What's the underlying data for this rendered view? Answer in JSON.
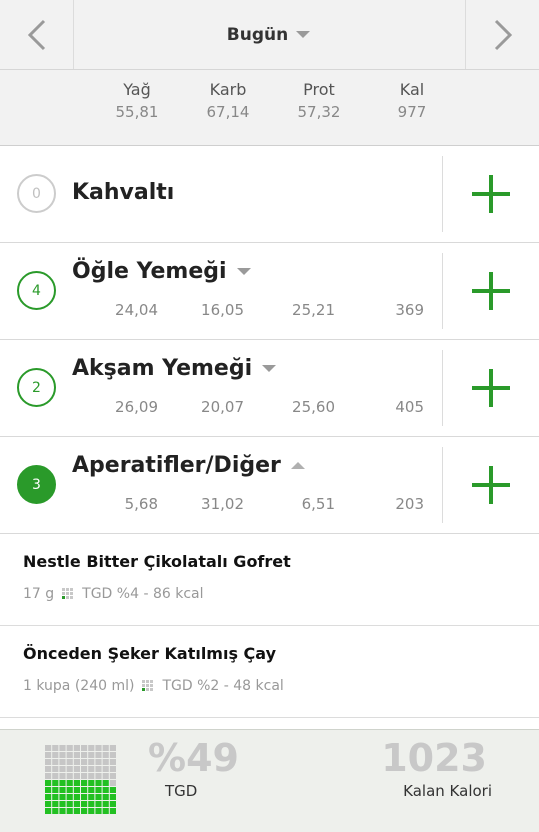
{
  "header": {
    "date_label": "Bugün"
  },
  "summary": {
    "fat": {
      "label": "Yağ",
      "value": "55,81"
    },
    "carb": {
      "label": "Karb",
      "value": "67,14"
    },
    "protein": {
      "label": "Prot",
      "value": "57,32"
    },
    "calories": {
      "label": "Kal",
      "value": "977"
    }
  },
  "meals": [
    {
      "count": "0",
      "name": "Kahvaltı"
    },
    {
      "count": "4",
      "name": "Öğle Yemeği",
      "fat": "24,04",
      "carb": "16,05",
      "protein": "25,21",
      "cal": "369"
    },
    {
      "count": "2",
      "name": "Akşam Yemeği",
      "fat": "26,09",
      "carb": "20,07",
      "protein": "25,60",
      "cal": "405"
    },
    {
      "count": "3",
      "name": "Aperatifler/Diğer",
      "fat": "5,68",
      "carb": "31,02",
      "protein": "6,51",
      "cal": "203"
    }
  ],
  "foods": [
    {
      "name": "Nestle Bitter Çikolatalı Gofret",
      "amount": "17  g",
      "tgd": "TGD %4 - 86 kcal"
    },
    {
      "name": "Önceden Şeker Katılmış Çay",
      "amount": "1  kupa (240 ml)",
      "tgd": "TGD %2 - 48 kcal"
    }
  ],
  "footer": {
    "tgd_percent": "%49",
    "tgd_label": "TGD",
    "tgd_fraction": 0.49,
    "remaining_value": "1023",
    "remaining_label": "Kalan Kalori"
  },
  "colors": {
    "accent": "#2a9a2a",
    "text_muted": "#888888"
  }
}
